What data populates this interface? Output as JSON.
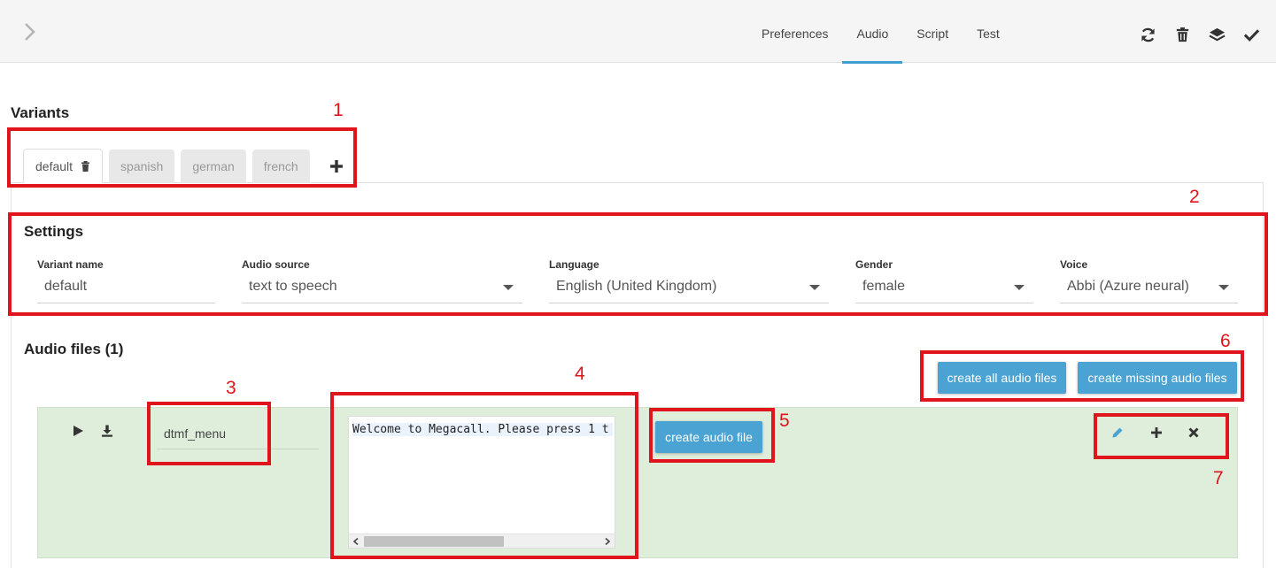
{
  "nav": {
    "tabs": [
      {
        "label": "Preferences"
      },
      {
        "label": "Audio"
      },
      {
        "label": "Script"
      },
      {
        "label": "Test"
      }
    ],
    "active_tab": "Audio",
    "icons": [
      "refresh-icon",
      "trash-icon",
      "layers-icon",
      "check-icon"
    ]
  },
  "variants": {
    "heading": "Variants",
    "tabs": [
      {
        "label": "default"
      },
      {
        "label": "spanish"
      },
      {
        "label": "german"
      },
      {
        "label": "french"
      }
    ]
  },
  "settings": {
    "heading": "Settings",
    "fields": [
      {
        "label": "Variant name",
        "value": "default"
      },
      {
        "label": "Audio source",
        "value": "text to speech"
      },
      {
        "label": "Language",
        "value": "English (United Kingdom)"
      },
      {
        "label": "Gender",
        "value": "female"
      },
      {
        "label": "Voice",
        "value": "Abbi (Azure neural)"
      }
    ]
  },
  "audio": {
    "heading": "Audio files (1)",
    "create_all_label": "create all audio files",
    "create_missing_label": "create missing audio files",
    "files": [
      {
        "name": "dtmf_menu",
        "text": "Welcome to Megacall. Please press 1 t",
        "create_label": "create audio file"
      }
    ]
  },
  "annotations": [
    "1",
    "2",
    "3",
    "4",
    "5",
    "6",
    "7"
  ],
  "colors": {
    "accent": "#4aa3d2",
    "row_bg": "#dfeedb",
    "annotation": "#e0141c"
  }
}
